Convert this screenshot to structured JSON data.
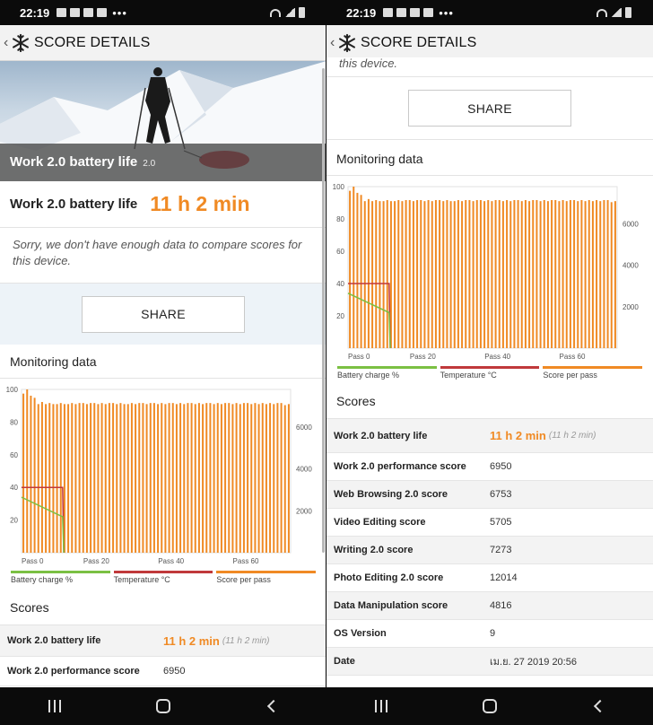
{
  "status": {
    "left": {
      "time": "22:19",
      "icons": [
        "facebook-icon",
        "gmail-icon",
        "facebook-icon",
        "youtube-icon"
      ],
      "more": "•••"
    },
    "right": {
      "time": "22:19",
      "icons": [
        "image-icon",
        "gmail-icon",
        "facebook-icon",
        "gmail-icon"
      ],
      "more": "•••"
    }
  },
  "header": {
    "title": "SCORE DETAILS",
    "back": "‹"
  },
  "hero": {
    "title": "Work 2.0 battery life",
    "version": "2.0"
  },
  "result": {
    "label": "Work 2.0 battery life",
    "value": "11 h 2 min"
  },
  "note": "Sorry, we don't have enough data to compare scores for this device.",
  "note_fragment": "this device.",
  "share_label": "SHARE",
  "monitoring_title": "Monitoring data",
  "legend": [
    {
      "label": "Battery charge %",
      "color": "#7bc043"
    },
    {
      "label": "Temperature °C",
      "color": "#c0393b"
    },
    {
      "label": "Score per pass",
      "color": "#f08a24"
    }
  ],
  "scores_title": "Scores",
  "scores": [
    {
      "name": "Work 2.0 battery life",
      "value": "11 h 2 min",
      "sub": "(11 h 2 min)",
      "highlight": true
    },
    {
      "name": "Work 2.0 performance score",
      "value": "6950"
    },
    {
      "name": "Web Browsing 2.0 score",
      "value": "6753"
    },
    {
      "name": "Video Editing score",
      "value": "5705"
    },
    {
      "name": "Writing 2.0 score",
      "value": "7273"
    },
    {
      "name": "Photo Editing 2.0 score",
      "value": "12014"
    },
    {
      "name": "Data Manipulation score",
      "value": "4816"
    },
    {
      "name": "OS Version",
      "value": "9"
    },
    {
      "name": "Date",
      "value": "เม.ย. 27 2019 20:56"
    }
  ],
  "chart_data": {
    "type": "bar",
    "title": "",
    "xlabel": "",
    "ylabel": "",
    "x_ticks": [
      "Pass 0",
      "Pass 20",
      "Pass 40",
      "Pass 60"
    ],
    "xlim": [
      0,
      72
    ],
    "y_left_ticks": [
      20,
      40,
      60,
      80,
      100
    ],
    "ylim_left": [
      0,
      100
    ],
    "y_right_ticks": [
      2000,
      4000,
      6000
    ],
    "ylim_right": [
      0,
      7800
    ],
    "series": [
      {
        "name": "Score per pass",
        "axis": "right",
        "values": [
          7600,
          7800,
          7500,
          7400,
          7100,
          7200,
          7100,
          7150,
          7100,
          7100,
          7150,
          7100,
          7100,
          7150,
          7100,
          7150,
          7150,
          7100,
          7150,
          7150,
          7100,
          7150,
          7100,
          7150,
          7150,
          7100,
          7150,
          7100,
          7100,
          7150,
          7100,
          7150,
          7150,
          7100,
          7150,
          7150,
          7100,
          7150,
          7100,
          7150,
          7150,
          7100,
          7150,
          7100,
          7150,
          7150,
          7100,
          7150,
          7100,
          7150,
          7150,
          7100,
          7150,
          7100,
          7150,
          7150,
          7100,
          7150,
          7100,
          7150,
          7150,
          7100,
          7150,
          7100,
          7150,
          7100,
          7150,
          7100,
          7150,
          7150,
          7050,
          7100
        ]
      },
      {
        "name": "Temperature °C",
        "axis": "left",
        "points": [
          [
            0,
            40
          ],
          [
            11,
            40
          ],
          [
            11.3,
            0
          ]
        ]
      },
      {
        "name": "Battery charge %",
        "axis": "left",
        "points": [
          [
            0,
            34
          ],
          [
            11,
            22
          ],
          [
            11.3,
            0
          ]
        ]
      }
    ]
  }
}
